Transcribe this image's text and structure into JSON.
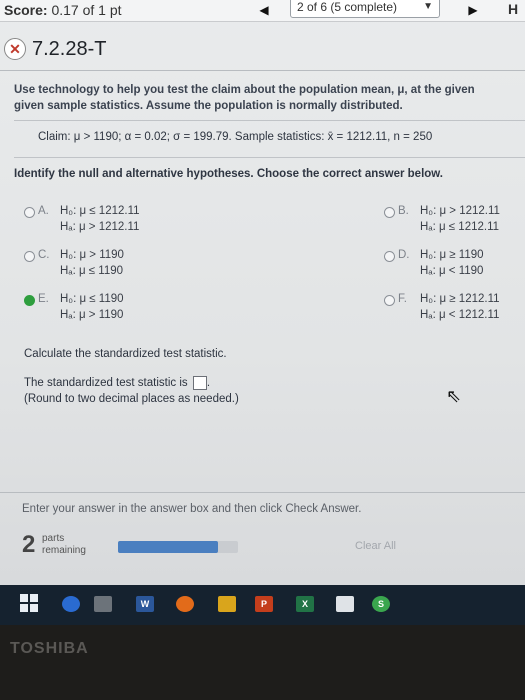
{
  "header": {
    "score_label": "Score:",
    "score_value": "0.17 of 1 pt",
    "progress_text": "2 of 6 (5 complete)",
    "right_letter": "H"
  },
  "question": {
    "id": "7.2.28-T",
    "prompt_line1": "Use technology to help you test the claim about the population mean, μ, at the given",
    "prompt_line2": "given sample statistics. Assume the population is normally distributed.",
    "claim": "Claim: μ > 1190; α = 0.02; σ = 199.79. Sample statistics: x̄ = 1212.11, n = 250",
    "instruction": "Identify the null and alternative hypotheses. Choose the correct answer below."
  },
  "options": [
    {
      "letter": "A.",
      "h0": "H₀: μ ≤ 1212.11",
      "ha": "Hₐ: μ > 1212.11",
      "selected": false
    },
    {
      "letter": "B.",
      "h0": "H₀: μ > 1212.11",
      "ha": "Hₐ: μ ≤ 1212.11",
      "selected": false
    },
    {
      "letter": "C.",
      "h0": "H₀: μ > 1190",
      "ha": "Hₐ: μ ≤ 1190",
      "selected": false
    },
    {
      "letter": "D.",
      "h0": "H₀: μ ≥ 1190",
      "ha": "Hₐ: μ < 1190",
      "selected": false
    },
    {
      "letter": "E.",
      "h0": "H₀: μ ≤ 1190",
      "ha": "Hₐ: μ > 1190",
      "selected": true
    },
    {
      "letter": "F.",
      "h0": "H₀: μ ≥ 1212.11",
      "ha": "Hₐ: μ < 1212.11",
      "selected": false
    }
  ],
  "part2": {
    "heading": "Calculate the standardized test statistic.",
    "label": "The standardized test statistic is",
    "answer_value": "",
    "round_note": "(Round to two decimal places as needed.)"
  },
  "footer": {
    "enter_text": "Enter your answer in the answer box and then click Check Answer.",
    "parts_count": "2",
    "parts_label1": "parts",
    "parts_label2": "remaining",
    "progress_fraction": 0.83,
    "clear_all": "Clear All"
  },
  "taskbar": {
    "word_label": "W",
    "powerpoint_label": "P",
    "excel_label": "X",
    "s_label": "S"
  },
  "bezel": {
    "brand": "TOSHIBA"
  }
}
